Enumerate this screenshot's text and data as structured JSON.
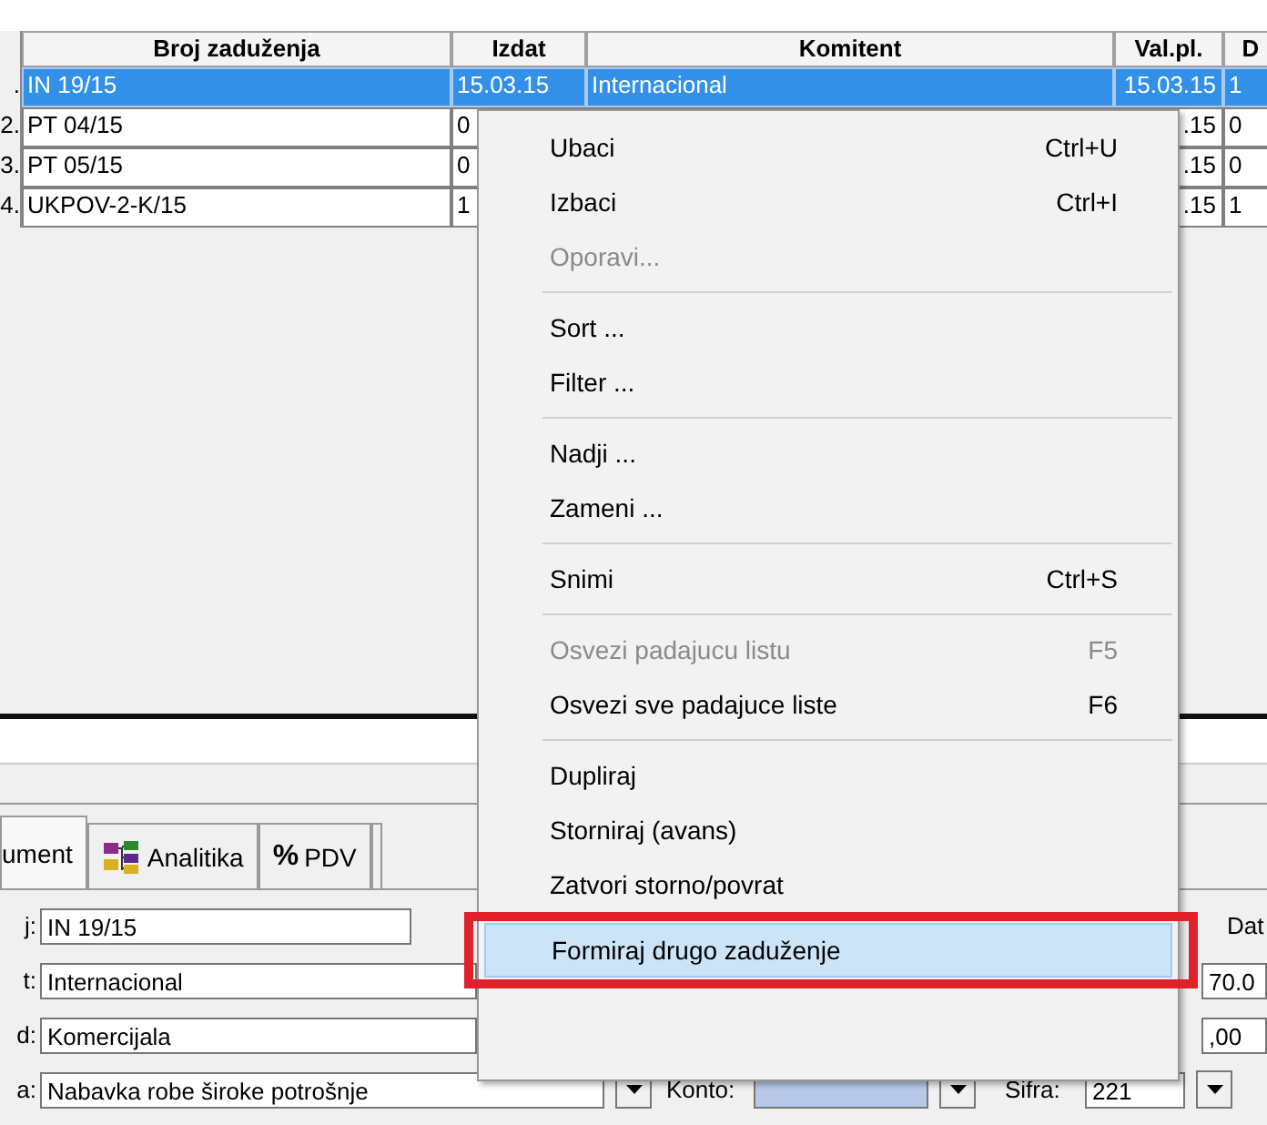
{
  "table": {
    "columns": [
      "Broj zaduženja",
      "Izdat",
      "Komitent",
      "Val.pl.",
      "D"
    ],
    "rows": [
      {
        "number": ".",
        "cells": [
          "IN 19/15",
          "15.03.15",
          "Internacional",
          "15.03.15",
          "1"
        ],
        "selected": true
      },
      {
        "number": "2.",
        "cells": [
          "PT 04/15",
          "0",
          "",
          ".15",
          "0"
        ],
        "selected": false
      },
      {
        "number": "3.",
        "cells": [
          "PT 05/15",
          "0",
          "",
          ".15",
          "0"
        ],
        "selected": false
      },
      {
        "number": "4.",
        "cells": [
          "UKPOV-2-K/15",
          "1",
          "",
          ".15",
          "1"
        ],
        "selected": false
      }
    ]
  },
  "tabs": [
    {
      "label": "ument",
      "kind": "plain",
      "selected": true
    },
    {
      "label": "Analitika",
      "kind": "analytics",
      "selected": false
    },
    {
      "label": "PDV",
      "kind": "percent",
      "icon": "%",
      "selected": false
    },
    {
      "kind": "stub",
      "selected": false
    }
  ],
  "form": {
    "rows": [
      {
        "label": "j:",
        "value": "IN 19/15",
        "right_label": "Dat"
      },
      {
        "label": "t:",
        "value": "Internacional",
        "right_value": "70.0"
      },
      {
        "label": "d:",
        "value": "Komercijala",
        "right_value": ",00"
      },
      {
        "label": "a:",
        "value": "Nabavka robe široke potrošnje",
        "konto_label": "Konto:",
        "sifra_label": "Šifra:",
        "sifra_value": "221"
      }
    ]
  },
  "context_menu": {
    "items": [
      {
        "kind": "item",
        "label": "Ubaci",
        "shortcut": "Ctrl+U",
        "disabled": false,
        "selected": false
      },
      {
        "kind": "item",
        "label": "Izbaci",
        "shortcut": "Ctrl+I",
        "disabled": false,
        "selected": false
      },
      {
        "kind": "item",
        "label": "Oporavi...",
        "disabled": true,
        "selected": false
      },
      {
        "kind": "separator"
      },
      {
        "kind": "item",
        "label": "Sort ...",
        "disabled": false,
        "selected": false
      },
      {
        "kind": "item",
        "label": "Filter ...",
        "disabled": false,
        "selected": false
      },
      {
        "kind": "separator"
      },
      {
        "kind": "item",
        "label": "Nadji ...",
        "disabled": false,
        "selected": false
      },
      {
        "kind": "item",
        "label": "Zameni ...",
        "disabled": false,
        "selected": false
      },
      {
        "kind": "separator"
      },
      {
        "kind": "item",
        "label": "Snimi",
        "shortcut": "Ctrl+S",
        "disabled": false,
        "selected": false
      },
      {
        "kind": "separator"
      },
      {
        "kind": "item",
        "label": "Osvezi padajucu listu",
        "shortcut": "F5",
        "disabled": true,
        "selected": false
      },
      {
        "kind": "item",
        "label": "Osvezi sve padajuce liste",
        "shortcut": "F6",
        "disabled": false,
        "selected": false
      },
      {
        "kind": "separator"
      },
      {
        "kind": "item",
        "label": "Dupliraj",
        "disabled": false,
        "selected": false
      },
      {
        "kind": "item",
        "label": "Storniraj (avans)",
        "disabled": false,
        "selected": false
      },
      {
        "kind": "item",
        "label": "Zatvori storno/povrat",
        "disabled": false,
        "selected": false
      },
      {
        "kind": "item",
        "label": "Formiraj drugo zaduženje",
        "disabled": false,
        "selected": true,
        "highlighted": true
      }
    ]
  }
}
